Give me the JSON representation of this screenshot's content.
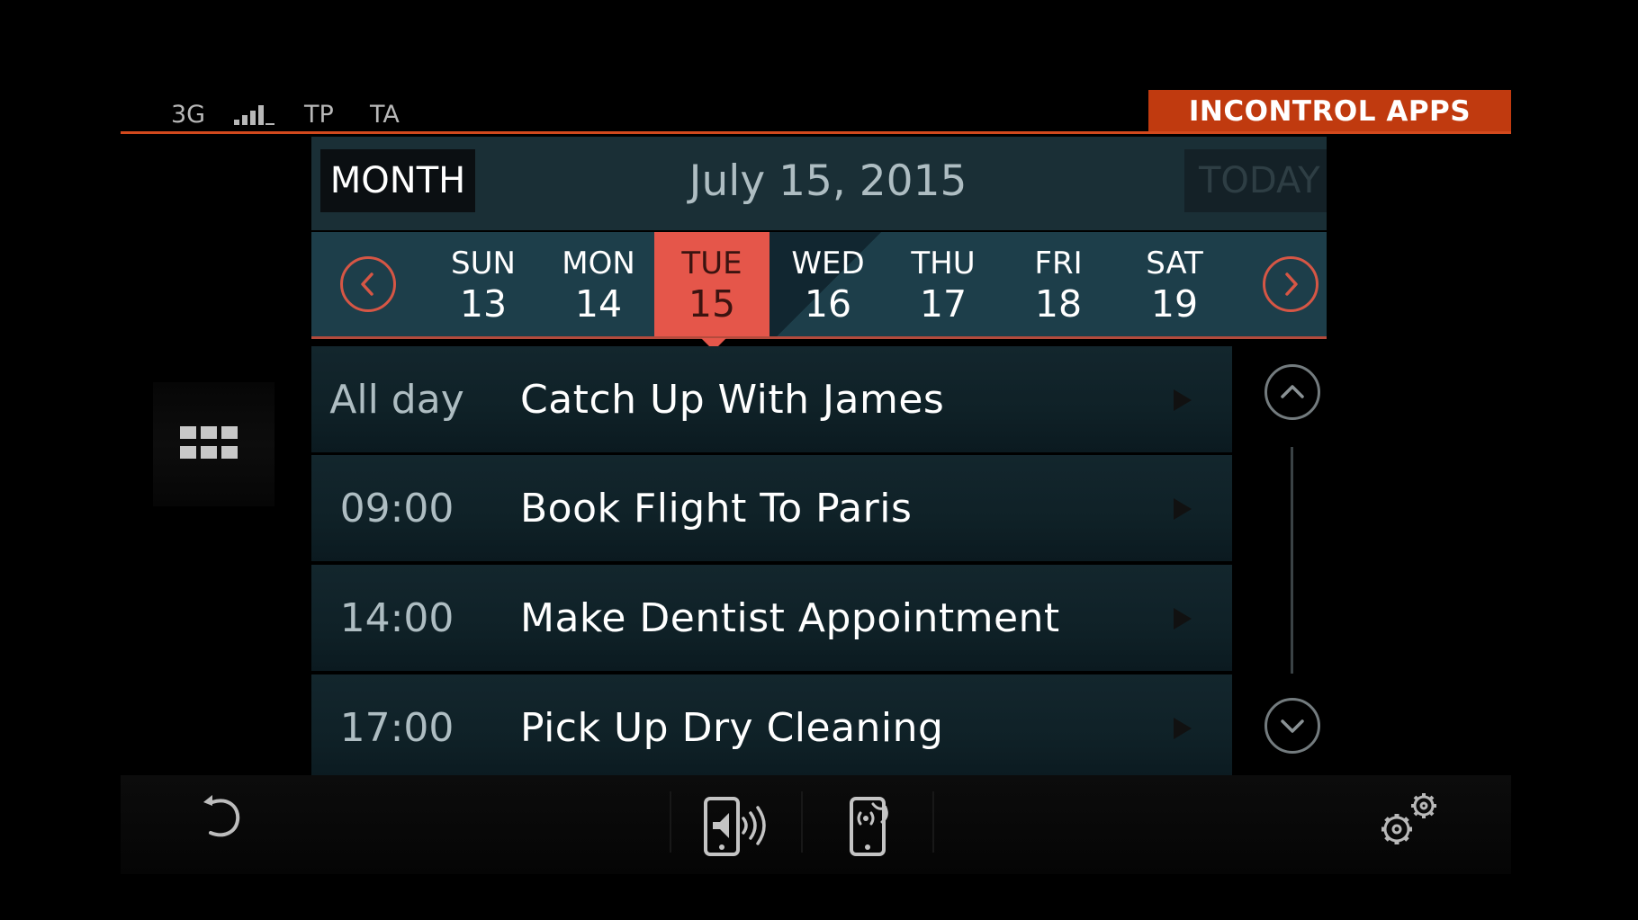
{
  "status_bar": {
    "network": "3G",
    "signal_icon": "signal-bars-icon",
    "tp": "TP",
    "ta": "TA"
  },
  "app_title": "INCONTROL APPS",
  "calendar": {
    "month_button": "MONTH",
    "date_title": "July 15, 2015",
    "today_button": "TODAY",
    "selected_day_index": 2,
    "week": [
      {
        "day": "SUN",
        "date": "13"
      },
      {
        "day": "MON",
        "date": "14"
      },
      {
        "day": "TUE",
        "date": "15"
      },
      {
        "day": "WED",
        "date": "16"
      },
      {
        "day": "THU",
        "date": "17"
      },
      {
        "day": "FRI",
        "date": "18"
      },
      {
        "day": "SAT",
        "date": "19"
      }
    ]
  },
  "events": [
    {
      "time": "All day",
      "title": "Catch Up With James"
    },
    {
      "time": "09:00",
      "title": "Book Flight To Paris"
    },
    {
      "time": "14:00",
      "title": "Make Dentist Appointment"
    },
    {
      "time": "17:00",
      "title": "Pick Up Dry Cleaning"
    }
  ],
  "icons": {
    "apps": "apps-grid-icon",
    "back": "back-arrow-icon",
    "speaker_phone": "phone-speaker-icon",
    "phone_voice": "phone-voice-icon",
    "settings": "settings-gears-icon",
    "prev": "chevron-left-icon",
    "next": "chevron-right-icon",
    "up": "chevron-up-icon",
    "down": "chevron-down-icon"
  },
  "colors": {
    "accent": "#c03a0f",
    "selected_day": "#e5564a",
    "header_bg": "#1a2f36",
    "week_bg": "#1d3e4a"
  }
}
